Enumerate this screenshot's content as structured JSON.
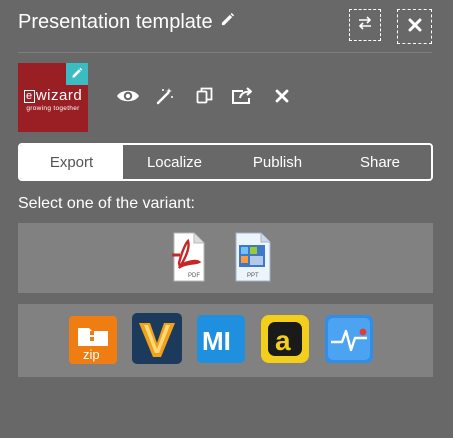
{
  "header": {
    "title": "Presentation template",
    "edit_icon": "pencil-icon",
    "swap_icon": "swap-arrows-icon",
    "close_icon": "close-icon"
  },
  "thumbnail": {
    "logo_text": "wizard",
    "logo_letter": "e",
    "logo_tagline": "growing together",
    "edit_icon": "pencil-icon",
    "accent": "#3bbcc2",
    "bg": "#9a1f24"
  },
  "actions": [
    {
      "icon": "eye-icon"
    },
    {
      "icon": "magic-wand-icon"
    },
    {
      "icon": "copy-icon"
    },
    {
      "icon": "share-out-icon"
    },
    {
      "icon": "close-icon"
    }
  ],
  "tabs": [
    {
      "label": "Export",
      "active": true
    },
    {
      "label": "Localize",
      "active": false
    },
    {
      "label": "Publish",
      "active": false
    },
    {
      "label": "Share",
      "active": false
    }
  ],
  "prompt": "Select one of the variant:",
  "export_formats_row1": [
    {
      "icon": "pdf-file-icon",
      "label": "PDF"
    },
    {
      "icon": "ppt-file-icon",
      "label": "PPT"
    }
  ],
  "export_formats_row2": [
    {
      "icon": "zip-folder-icon",
      "label": "zip"
    },
    {
      "icon": "veeva-icon",
      "label": "V"
    },
    {
      "icon": "mi-icon",
      "label": "MI"
    },
    {
      "icon": "a-icon",
      "label": "a"
    },
    {
      "icon": "pulse-app-icon",
      "label": ""
    }
  ],
  "colors": {
    "background": "#686868",
    "panel": "#818181",
    "text": "#ffffff",
    "active_tab_text": "#555555"
  }
}
